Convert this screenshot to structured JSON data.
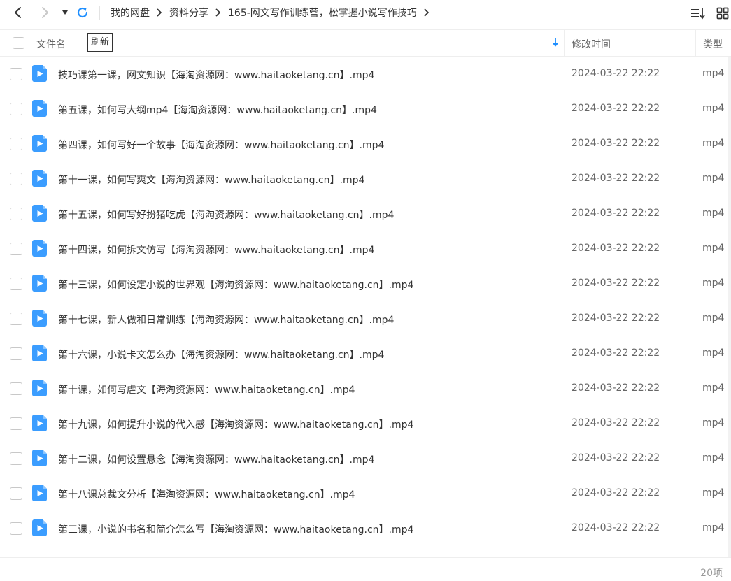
{
  "breadcrumb": [
    "我的网盘",
    "资料分享",
    "165-网文写作训练营，松掌握小说写作技巧"
  ],
  "header": {
    "name_label": "文件名",
    "refresh_tooltip": "刷新",
    "time_label": "修改时间",
    "type_label": "类型"
  },
  "icons": {
    "back": "chevron-left-icon",
    "forward": "chevron-right-icon",
    "dropdown": "caret-down-icon",
    "refresh": "refresh-icon",
    "sort": "sort-list-icon",
    "grid": "grid-view-icon",
    "file": "video-file-icon"
  },
  "colors": {
    "accent": "#06a7ff",
    "refresh": "#1f8fff",
    "file_icon": "#3b9dff"
  },
  "files": [
    {
      "name": "技巧课第一课，网文知识【海淘资源网：www.haitaoketang.cn】.mp4",
      "time": "2024-03-22 22:22",
      "type": "mp4"
    },
    {
      "name": "第五课，如何写大纲mp4【海淘资源网：www.haitaoketang.cn】.mp4",
      "time": "2024-03-22 22:22",
      "type": "mp4"
    },
    {
      "name": "第四课，如何写好一个故事【海淘资源网：www.haitaoketang.cn】.mp4",
      "time": "2024-03-22 22:22",
      "type": "mp4"
    },
    {
      "name": "第十一课，如何写爽文【海淘资源网：www.haitaoketang.cn】.mp4",
      "time": "2024-03-22 22:22",
      "type": "mp4"
    },
    {
      "name": "第十五课，如何写好扮猪吃虎【海淘资源网：www.haitaoketang.cn】.mp4",
      "time": "2024-03-22 22:22",
      "type": "mp4"
    },
    {
      "name": "第十四课，如何拆文仿写【海淘资源网：www.haitaoketang.cn】.mp4",
      "time": "2024-03-22 22:22",
      "type": "mp4"
    },
    {
      "name": "第十三课，如何设定小说的世界观【海淘资源网：www.haitaoketang.cn】.mp4",
      "time": "2024-03-22 22:22",
      "type": "mp4"
    },
    {
      "name": "第十七课，新人做和日常训练【海淘资源网：www.haitaoketang.cn】.mp4",
      "time": "2024-03-22 22:22",
      "type": "mp4"
    },
    {
      "name": "第十六课，小说卡文怎么办【海淘资源网：www.haitaoketang.cn】.mp4",
      "time": "2024-03-22 22:22",
      "type": "mp4"
    },
    {
      "name": "第十课，如何写虐文【海淘资源网：www.haitaoketang.cn】.mp4",
      "time": "2024-03-22 22:22",
      "type": "mp4"
    },
    {
      "name": "第十九课，如何提升小说的代入感【海淘资源网：www.haitaoketang.cn】.mp4",
      "time": "2024-03-22 22:22",
      "type": "mp4"
    },
    {
      "name": "第十二课，如何设置悬念【海淘资源网：www.haitaoketang.cn】.mp4",
      "time": "2024-03-22 22:22",
      "type": "mp4"
    },
    {
      "name": "第十八课总裁文分析【海淘资源网：www.haitaoketang.cn】.mp4",
      "time": "2024-03-22 22:22",
      "type": "mp4"
    },
    {
      "name": "第三课，小说的书名和简介怎么写【海淘资源网：www.haitaoketang.cn】.mp4",
      "time": "2024-03-22 22:22",
      "type": "mp4"
    }
  ],
  "footer": {
    "count": "20项"
  }
}
